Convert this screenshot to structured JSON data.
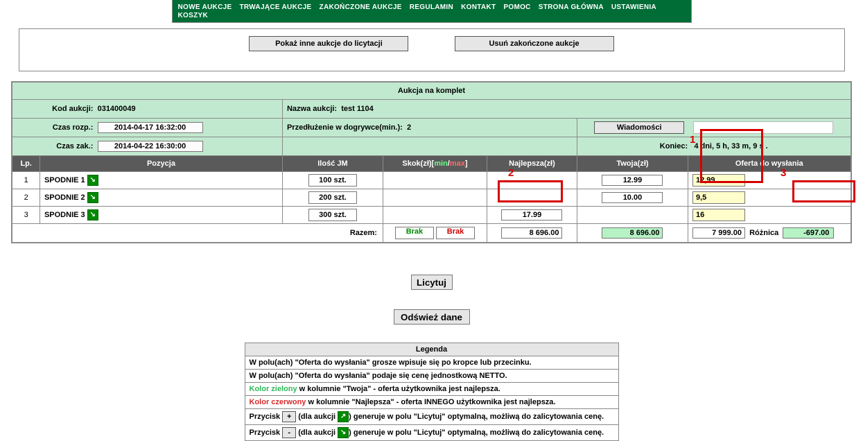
{
  "nav": [
    "NOWE AUKCJE",
    "TRWAJĄCE AUKCJE",
    "ZAKOŃCZONE AUKCJE",
    "REGULAMIN",
    "KONTAKT",
    "POMOC",
    "STRONA GŁÓWNA",
    "USTAWIENIA",
    "KOSZYK"
  ],
  "topButtons": {
    "show": "Pokaż inne aukcje do licytacji",
    "remove": "Usuń zakończone aukcje"
  },
  "auction": {
    "title": "Aukcja na komplet",
    "kodLbl": "Kod aukcji:",
    "kod": "031400049",
    "nazwaLbl": "Nazwa aukcji:",
    "nazwa": "test 1104",
    "rozpLbl": "Czas rozp.:",
    "rozp": "2014-04-17 16:32:00",
    "przedLbl": "Przedłużenie w dogrywce(min.):",
    "przed": "2",
    "wiadomosci": "Wiadomości",
    "zakLbl": "Czas zak.:",
    "zak": "2014-04-22 16:30:00",
    "koniecLbl": "Koniec:",
    "koniec": "4 dni, 5 h, 33 m, 9 s ."
  },
  "hdr": {
    "lp": "Lp.",
    "poz": "Pozycja",
    "ilosc": "Ilość JM",
    "skok1": "Skok(zł)[",
    "skokMin": "min",
    "skokSep": "/",
    "skokMax": "max",
    "skok2": "]",
    "najlepsza": "Najlepsza(zł)",
    "twoja": "Twoja(zł)",
    "oferta": "Oferta do wysłania"
  },
  "rows": [
    {
      "lp": "1",
      "poz": "SPODNIE 1",
      "qty": "100 szt.",
      "twoja": "12.99",
      "offer": "12,99"
    },
    {
      "lp": "2",
      "poz": "SPODNIE 2",
      "qty": "200 szt.",
      "twoja": "10.00",
      "offer": "9,5"
    },
    {
      "lp": "3",
      "poz": "SPODNIE 3",
      "qty": "300 szt.",
      "najlepsza": "17.99",
      "offer": "16"
    }
  ],
  "sum": {
    "razem": "Razem:",
    "brakG": "Brak",
    "brakR": "Brak",
    "najlepsza": "8 696.00",
    "twoja": "8 696.00",
    "oferta": "7 999.00",
    "roznicaLbl": "Różnica",
    "roznica": "-697.00"
  },
  "licytuj": "Licytuj",
  "odswiez": "Odśwież dane",
  "legend": {
    "title": "Legenda",
    "l1": "W polu(ach) \"Oferta do wysłania\" grosze wpisuje się po kropce lub przecinku.",
    "l2": "W polu(ach) \"Oferta do wysłania\" podaje się cenę jednostkową NETTO.",
    "l3a": "Kolor zielony",
    "l3b": " w kolumnie \"Twoja\" - oferta użytkownika jest najlepsza.",
    "l4a": "Kolor czerwony",
    "l4b": " w kolumnie \"Najlepsza\" - oferta INNEGO użytkownika jest najlepsza.",
    "l5a": "Przycisk ",
    "l5b": "+",
    "l5c": " (dla aukcji ",
    "l5d": ") generuje w polu \"Licytuj\" optymalną, możliwą do zalicytowania cenę.",
    "l6a": "Przycisk ",
    "l6b": "-",
    "l6c": " (dla aukcji ",
    "l6d": ") generuje w polu \"Licytuj\" optymalną, możliwą do zalicytowania cenę."
  }
}
